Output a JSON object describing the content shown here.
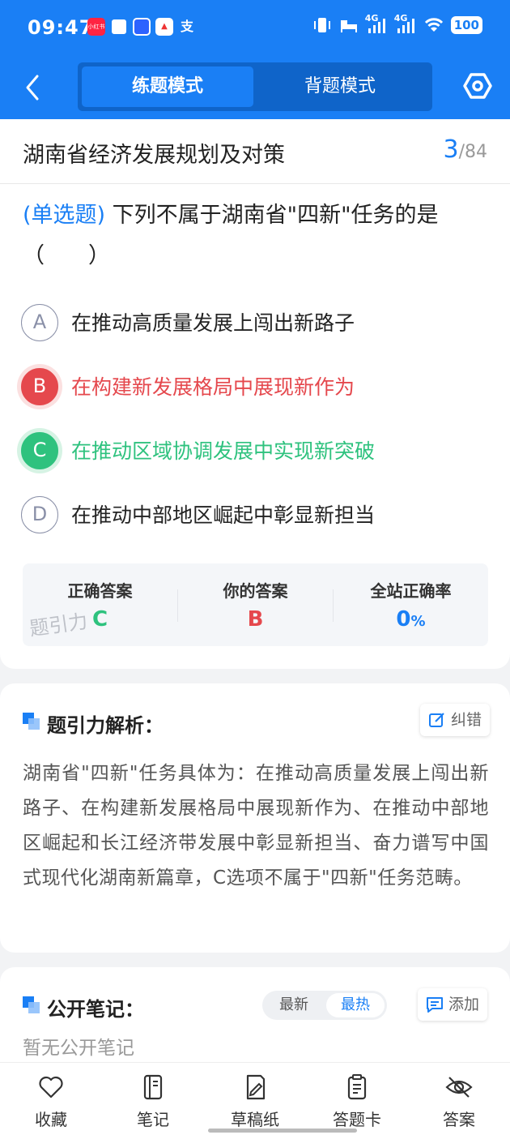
{
  "status_bar": {
    "time": "09:47",
    "app_badges": [
      "小红书",
      "",
      "",
      "",
      "支"
    ],
    "signal_label_1": "4G",
    "signal_label_2": "4G",
    "battery": "100"
  },
  "header": {
    "tabs": [
      {
        "label": "练题模式",
        "active": true
      },
      {
        "label": "背题模式",
        "active": false
      }
    ],
    "back_icon": "chevron-left-icon",
    "settings_icon": "gear-hexagon-icon"
  },
  "chapter": {
    "title": "湖南省经济发展规划及对策",
    "current": "3",
    "separator": "/",
    "total": "84"
  },
  "question": {
    "type": "(单选题)",
    "text": "下列不属于湖南省\"四新\"任务的是（　　）",
    "options": [
      {
        "letter": "A",
        "text": "在推动高质量发展上闯出新路子",
        "state": "normal"
      },
      {
        "letter": "B",
        "text": "在构建新发展格局中展现新作为",
        "state": "wrong"
      },
      {
        "letter": "C",
        "text": "在推动区域协调发展中实现新突破",
        "state": "correct"
      },
      {
        "letter": "D",
        "text": "在推动中部地区崛起中彰显新担当",
        "state": "normal"
      }
    ]
  },
  "answer_summary": {
    "correct_label": "正确答案",
    "correct_value": "C",
    "yours_label": "你的答案",
    "yours_value": "B",
    "rate_label": "全站正确率",
    "rate_value": "0",
    "rate_unit": "%",
    "watermark": "题引力"
  },
  "analysis": {
    "title": "题引力解析：",
    "report_button": "纠错",
    "text": "湖南省\"四新\"任务具体为：在推动高质量发展上闯出新路子、在构建新发展格局中展现新作为、在推动中部地区崛起和长江经济带发展中彰显新担当、奋力谱写中国式现代化湖南新篇章，C选项不属于\"四新\"任务范畴。"
  },
  "notes": {
    "title": "公开笔记：",
    "sort_options": [
      "最新",
      "最热"
    ],
    "sort_active": "最热",
    "add_button": "添加",
    "empty_text": "暂无公开笔记"
  },
  "bottom_bar": [
    {
      "label": "收藏",
      "icon": "heart-icon"
    },
    {
      "label": "笔记",
      "icon": "notebook-icon"
    },
    {
      "label": "草稿纸",
      "icon": "draft-paper-icon"
    },
    {
      "label": "答题卡",
      "icon": "answer-sheet-icon"
    },
    {
      "label": "答案",
      "icon": "eye-off-icon"
    }
  ],
  "colors": {
    "primary": "#1a7ff5",
    "wrong": "#e5484d",
    "correct": "#2ec27e"
  }
}
